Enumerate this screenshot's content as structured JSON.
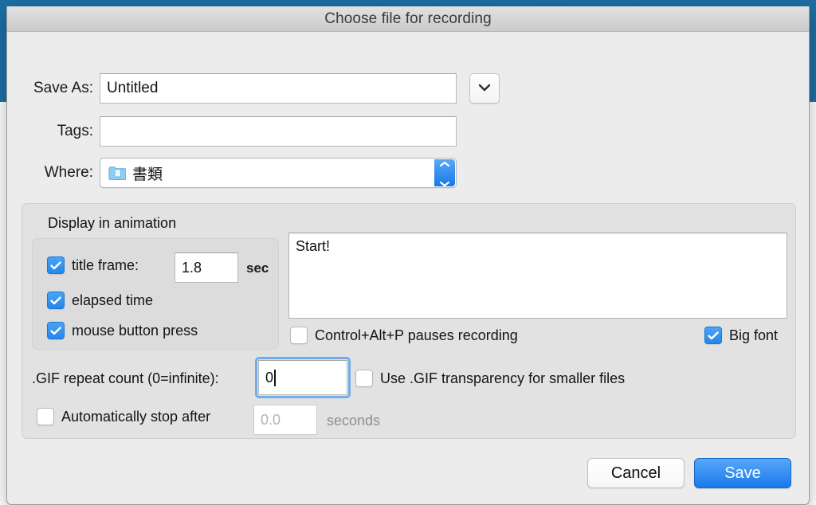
{
  "window": {
    "title": "Choose file for recording"
  },
  "form": {
    "save_as": {
      "label": "Save As:",
      "value": "Untitled",
      "expand_icon": "chevron-down-icon"
    },
    "tags": {
      "label": "Tags:",
      "value": ""
    },
    "where": {
      "label": "Where:",
      "value": "書類",
      "folder_icon": "documents-folder-icon",
      "stepper_icon": "chevron-up-down-icon"
    }
  },
  "accessory": {
    "group_title": "Display in animation",
    "options": [
      {
        "label": "title frame:",
        "checked": true
      },
      {
        "label": "elapsed time",
        "checked": true
      },
      {
        "label": "mouse button press",
        "checked": true
      }
    ],
    "title_frame_seconds": "1.8",
    "seconds_unit": "sec",
    "title_text": "Start!",
    "pause_hotkey": {
      "label": "Control+Alt+P pauses recording",
      "checked": false
    },
    "big_font": {
      "label": "Big font",
      "checked": true
    },
    "repeat_count": {
      "label": ".GIF repeat count (0=infinite):",
      "value": "0"
    },
    "transparency": {
      "label": "Use .GIF transparency for smaller files",
      "checked": false
    },
    "auto_stop": {
      "label": "Automatically stop after",
      "checked": false,
      "value_placeholder": "0.0",
      "unit": "seconds"
    }
  },
  "buttons": {
    "cancel": "Cancel",
    "save": "Save"
  },
  "colors": {
    "accent_blue": "#2387ec",
    "sheet_bg": "#ececec",
    "panel_bg": "#e2e2e2",
    "background_window_blue": "#1c6ea4"
  }
}
